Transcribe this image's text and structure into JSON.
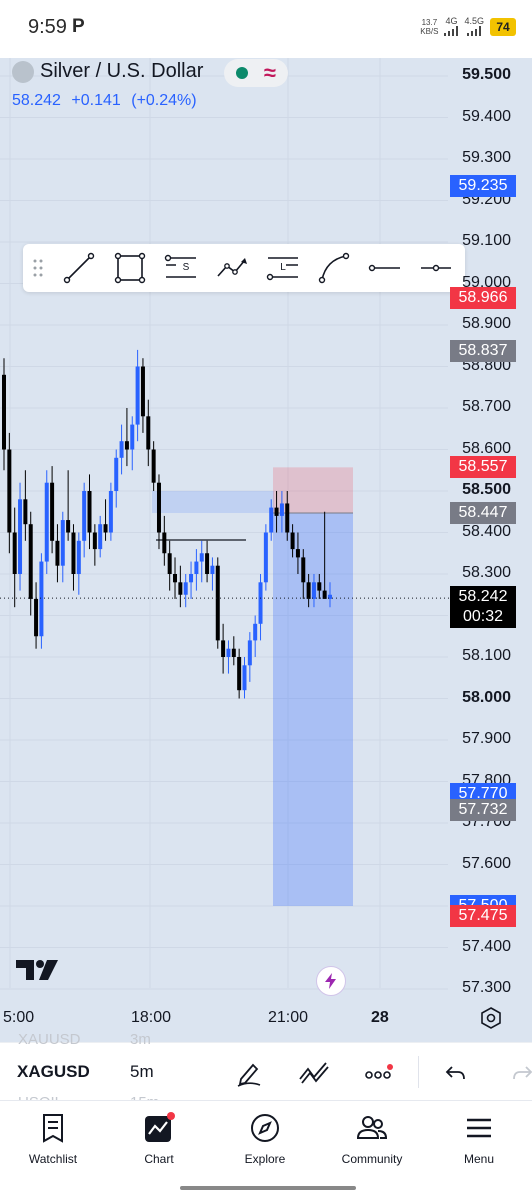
{
  "status_bar": {
    "time": "9:59",
    "app_indicator": "P",
    "net_speed_value": "13.7",
    "net_speed_unit": "KB/S",
    "net_4g": "4G",
    "net_4g_b": "4.5G",
    "battery": "74"
  },
  "header": {
    "symbol_name": "Silver / U.S. Dollar",
    "last_price": "58.242",
    "change": "+0.141",
    "change_pct": "(+0.24%)",
    "market_status_icon": "green-dot-icon",
    "delayed_icon": "approx-icon"
  },
  "drawing_toolbar": {
    "tools": [
      {
        "name": "trend-line-tool"
      },
      {
        "name": "rectangle-tool"
      },
      {
        "name": "short-position-tool",
        "letter": "S"
      },
      {
        "name": "path-tool"
      },
      {
        "name": "long-position-tool",
        "letter": "L"
      },
      {
        "name": "curve-tool"
      },
      {
        "name": "horizontal-ray-tool"
      },
      {
        "name": "horizontal-line-tool"
      }
    ]
  },
  "price_axis": {
    "labels": [
      "59.500",
      "59.400",
      "59.300",
      "59.200",
      "59.100",
      "59.000",
      "58.900",
      "58.800",
      "58.700",
      "58.600",
      "58.500",
      "58.400",
      "58.300",
      "58.200",
      "58.100",
      "58.000",
      "57.900",
      "57.800",
      "57.700",
      "57.600",
      "57.500",
      "57.400",
      "57.300"
    ],
    "bold_labels": [
      "59.500",
      "58.500",
      "58.000"
    ],
    "tags": [
      {
        "value": "59.235",
        "color": "#2962ff"
      },
      {
        "value": "58.966",
        "color": "#f23645"
      },
      {
        "value": "58.837",
        "color": "#787b86"
      },
      {
        "value": "58.557",
        "color": "#f23645"
      },
      {
        "value": "58.447",
        "color": "#787b86"
      },
      {
        "value": "57.770",
        "color": "#2962ff"
      },
      {
        "value": "57.732",
        "color": "#787b86"
      },
      {
        "value": "57.500",
        "color": "#2962ff"
      },
      {
        "value": "57.475",
        "color": "#f23645"
      }
    ],
    "current_price": {
      "value": "58.242",
      "countdown": "00:32"
    }
  },
  "time_axis": {
    "labels": [
      "5:00",
      "18:00",
      "21:00",
      "28"
    ]
  },
  "chart_data": {
    "type": "candlestick",
    "symbol": "XAGUSD",
    "interval": "5m",
    "ylim": [
      57.25,
      59.58
    ],
    "candles": [
      [
        58.78,
        58.82,
        58.55,
        58.6
      ],
      [
        58.6,
        58.64,
        58.35,
        58.4
      ],
      [
        58.4,
        58.46,
        58.22,
        58.3
      ],
      [
        58.3,
        58.52,
        58.26,
        58.48
      ],
      [
        58.48,
        58.55,
        58.38,
        58.42
      ],
      [
        58.42,
        58.45,
        58.2,
        58.24
      ],
      [
        58.24,
        58.28,
        58.12,
        58.15
      ],
      [
        58.15,
        58.35,
        58.12,
        58.33
      ],
      [
        58.33,
        58.55,
        58.3,
        58.52
      ],
      [
        58.52,
        58.56,
        58.35,
        58.38
      ],
      [
        58.38,
        58.42,
        58.28,
        58.32
      ],
      [
        58.32,
        58.45,
        58.28,
        58.43
      ],
      [
        58.43,
        58.55,
        58.38,
        58.4
      ],
      [
        58.4,
        58.42,
        58.26,
        58.3
      ],
      [
        58.3,
        58.4,
        58.25,
        58.38
      ],
      [
        58.38,
        58.52,
        58.34,
        58.5
      ],
      [
        58.5,
        58.54,
        58.36,
        58.4
      ],
      [
        58.4,
        58.42,
        58.32,
        58.36
      ],
      [
        58.36,
        58.44,
        58.34,
        58.42
      ],
      [
        58.42,
        58.48,
        58.38,
        58.4
      ],
      [
        58.4,
        58.52,
        58.38,
        58.5
      ],
      [
        58.5,
        58.6,
        58.46,
        58.58
      ],
      [
        58.58,
        58.66,
        58.54,
        58.62
      ],
      [
        58.62,
        58.7,
        58.56,
        58.6
      ],
      [
        58.6,
        58.68,
        58.55,
        58.66
      ],
      [
        58.66,
        58.84,
        58.62,
        58.8
      ],
      [
        58.8,
        58.82,
        58.64,
        58.68
      ],
      [
        58.68,
        58.72,
        58.56,
        58.6
      ],
      [
        58.6,
        58.62,
        58.5,
        58.52
      ],
      [
        58.52,
        58.54,
        58.36,
        58.4
      ],
      [
        58.4,
        58.44,
        58.32,
        58.35
      ],
      [
        58.35,
        58.38,
        58.26,
        58.3
      ],
      [
        58.3,
        58.34,
        58.24,
        58.28
      ],
      [
        58.28,
        58.32,
        58.22,
        58.25
      ],
      [
        58.25,
        58.3,
        58.22,
        58.28
      ],
      [
        58.28,
        58.33,
        58.24,
        58.3
      ],
      [
        58.3,
        58.36,
        58.26,
        58.33
      ],
      [
        58.33,
        58.38,
        58.28,
        58.35
      ],
      [
        58.35,
        58.38,
        58.28,
        58.3
      ],
      [
        58.3,
        58.34,
        58.26,
        58.32
      ],
      [
        58.32,
        58.34,
        58.12,
        58.14
      ],
      [
        58.14,
        58.18,
        58.06,
        58.1
      ],
      [
        58.1,
        58.14,
        58.06,
        58.12
      ],
      [
        58.12,
        58.15,
        58.08,
        58.1
      ],
      [
        58.1,
        58.12,
        58.0,
        58.02
      ],
      [
        58.02,
        58.1,
        58.0,
        58.08
      ],
      [
        58.08,
        58.16,
        58.04,
        58.14
      ],
      [
        58.14,
        58.2,
        58.1,
        58.18
      ],
      [
        58.18,
        58.3,
        58.14,
        58.28
      ],
      [
        58.28,
        58.42,
        58.26,
        58.4
      ],
      [
        58.4,
        58.48,
        58.38,
        58.46
      ],
      [
        58.46,
        58.5,
        58.4,
        58.44
      ],
      [
        58.44,
        58.5,
        58.4,
        58.47
      ],
      [
        58.47,
        58.5,
        58.38,
        58.4
      ],
      [
        58.4,
        58.42,
        58.34,
        58.36
      ],
      [
        58.36,
        58.4,
        58.3,
        58.34
      ],
      [
        58.34,
        58.36,
        58.24,
        58.28
      ],
      [
        58.28,
        58.3,
        58.22,
        58.24
      ],
      [
        58.24,
        58.3,
        58.22,
        58.28
      ],
      [
        58.28,
        58.3,
        58.24,
        58.26
      ],
      [
        58.26,
        58.45,
        58.24,
        58.24
      ],
      [
        58.24,
        58.28,
        58.22,
        58.25
      ]
    ],
    "position_tool": {
      "type": "short",
      "entry": 58.447,
      "stop": 58.557,
      "target": 57.5
    },
    "zones": [
      {
        "from": 58.447,
        "to": 58.5,
        "label": "supply-zone"
      }
    ],
    "lines": [
      {
        "price": 58.382,
        "label": "horizontal-level"
      }
    ]
  },
  "bottom_bar": {
    "symbol_prev": "XAUUSD",
    "tf_prev": "3m",
    "symbol": "XAGUSD",
    "timeframe": "5m",
    "symbol_next": "USOIL",
    "tf_next": "15m"
  },
  "nav": {
    "items": [
      {
        "label": "Watchlist",
        "icon": "watchlist-icon"
      },
      {
        "label": "Chart",
        "icon": "chart-icon"
      },
      {
        "label": "Explore",
        "icon": "compass-icon"
      },
      {
        "label": "Community",
        "icon": "community-icon"
      },
      {
        "label": "Menu",
        "icon": "menu-icon"
      }
    ]
  }
}
